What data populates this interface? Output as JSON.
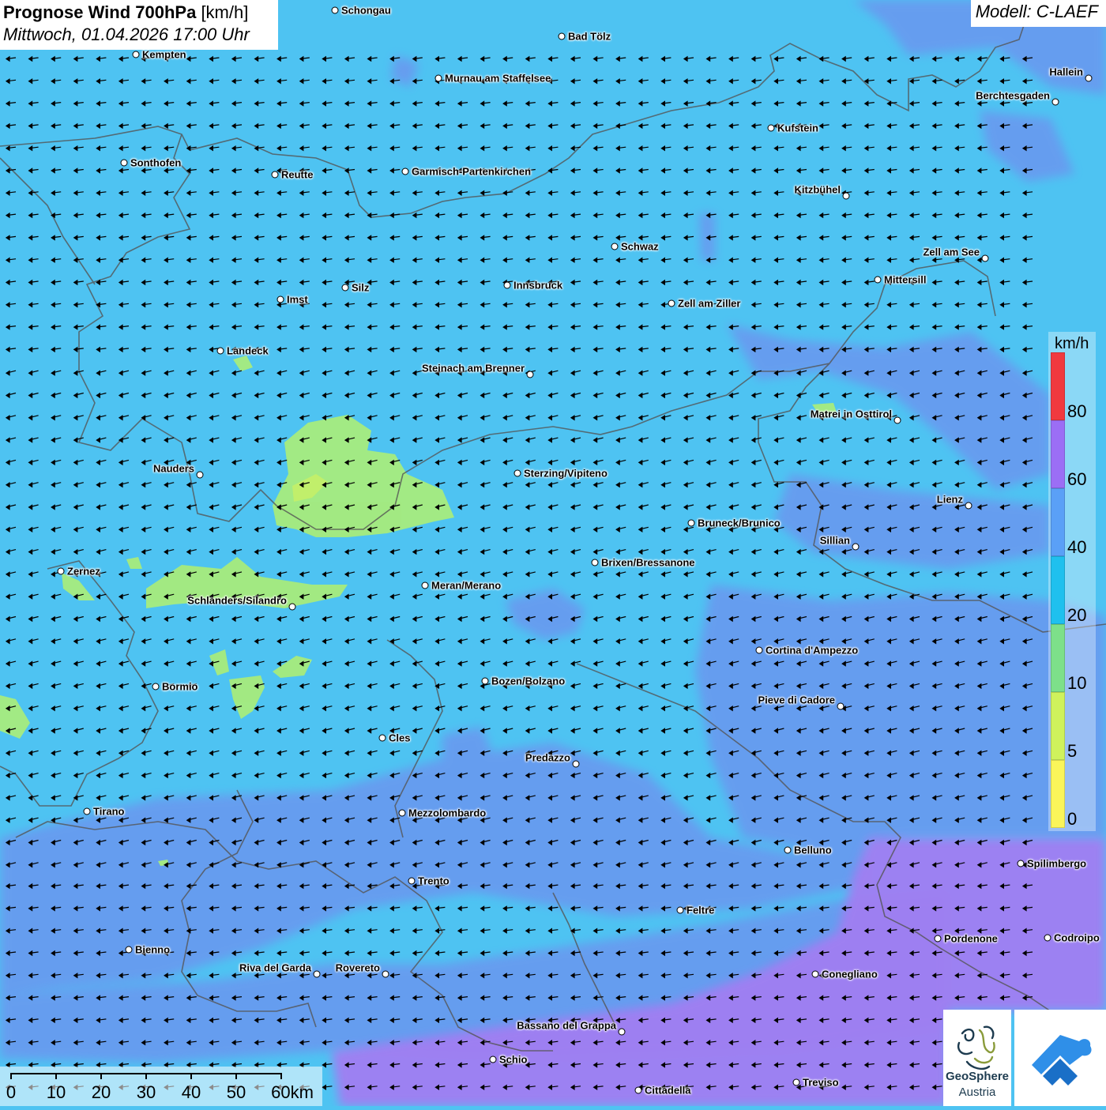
{
  "header": {
    "title_bold": "Prognose Wind 700hPa",
    "title_unit": "[km/h]",
    "datetime": "Mittwoch, 01.04.2026 17:00 Uhr",
    "model": "Modell: C-LAEF"
  },
  "legend": {
    "unit": "km/h",
    "ticks": [
      "80",
      "60",
      "40",
      "20",
      "10",
      "5",
      "0"
    ],
    "colors": [
      "#f0393f",
      "#9b6ef5",
      "#5aa0f7",
      "#1fc0ee",
      "#7de08a",
      "#cff25c",
      "#faf55a"
    ]
  },
  "scalebar": {
    "labels": [
      "0",
      "10",
      "20",
      "30",
      "40",
      "50",
      "60km"
    ]
  },
  "logos": {
    "geosphere_line1": "GeoSphere",
    "geosphere_line2": "Austria"
  },
  "wind": {
    "direction": "from east-northeast (arrows pointing west-southwest)"
  },
  "cities": [
    {
      "name": "Schongau",
      "label": "Schongau",
      "side": "right"
    },
    {
      "name": "Bad Tölz",
      "label": "Bad Tölz",
      "side": "right"
    },
    {
      "name": "Kempten",
      "label": "Kempten",
      "side": "right"
    },
    {
      "name": "Murnau am Staffelsee",
      "label": "Murnau am Staffelsee",
      "side": "right"
    },
    {
      "name": "Hallein",
      "label": "Hallein",
      "side": "left"
    },
    {
      "name": "Berchtesgaden",
      "label": "Berchtesgaden",
      "side": "left"
    },
    {
      "name": "Kufstein",
      "label": "Kufstein",
      "side": "right"
    },
    {
      "name": "Sonthofen",
      "label": "Sonthofen",
      "side": "right"
    },
    {
      "name": "Reutte",
      "label": "Reutte",
      "side": "right"
    },
    {
      "name": "Garmisch-Partenkirchen",
      "label": "Garmisch-Partenkirchen",
      "side": "right"
    },
    {
      "name": "Kitzbühel",
      "label": "Kitzbühel",
      "side": "left"
    },
    {
      "name": "Schwaz",
      "label": "Schwaz",
      "side": "right"
    },
    {
      "name": "Zell am See",
      "label": "Zell am See",
      "side": "left"
    },
    {
      "name": "Mittersill",
      "label": "Mittersill",
      "side": "right"
    },
    {
      "name": "Innsbruck",
      "label": "Innsbruck",
      "side": "right"
    },
    {
      "name": "Silz",
      "label": "Silz",
      "side": "right"
    },
    {
      "name": "Imst",
      "label": "Imst",
      "side": "right"
    },
    {
      "name": "Zell am Ziller",
      "label": "Zell am Ziller",
      "side": "right"
    },
    {
      "name": "Landeck",
      "label": "Landeck",
      "side": "right"
    },
    {
      "name": "Steinach am Brenner",
      "label": "Steinach am Brenner",
      "side": "left"
    },
    {
      "name": "Matrei in Osttirol",
      "label": "Matrei in Osttirol",
      "side": "left"
    },
    {
      "name": "Nauders",
      "label": "Nauders",
      "side": "left"
    },
    {
      "name": "Sterzing/Vipiteno",
      "label": "Sterzing/Vipiteno",
      "side": "right"
    },
    {
      "name": "Lienz",
      "label": "Lienz",
      "side": "left"
    },
    {
      "name": "Bruneck/Brunico",
      "label": "Bruneck/Brunico",
      "side": "right"
    },
    {
      "name": "Sillian",
      "label": "Sillian",
      "side": "left"
    },
    {
      "name": "Brixen/Bressanone",
      "label": "Brixen/Bressanone",
      "side": "right"
    },
    {
      "name": "Zernez",
      "label": "Zernez",
      "side": "right"
    },
    {
      "name": "Meran/Merano",
      "label": "Meran/Merano",
      "side": "right"
    },
    {
      "name": "Schlanders/Silandro",
      "label": "Schlanders/Silandro",
      "side": "left"
    },
    {
      "name": "Cortina d'Ampezzo",
      "label": "Cortina d'Ampezzo",
      "side": "right"
    },
    {
      "name": "Bozen/Bolzano",
      "label": "Bozen/Bolzano",
      "side": "right"
    },
    {
      "name": "Bormio",
      "label": "Bormio",
      "side": "right"
    },
    {
      "name": "Pieve di Cadore",
      "label": "Pieve di Cadore",
      "side": "left"
    },
    {
      "name": "Cles",
      "label": "Cles",
      "side": "right"
    },
    {
      "name": "Predazzo",
      "label": "Predazzo",
      "side": "left"
    },
    {
      "name": "Tirano",
      "label": "Tirano",
      "side": "right"
    },
    {
      "name": "Mezzolombardo",
      "label": "Mezzolombardo",
      "side": "right"
    },
    {
      "name": "Belluno",
      "label": "Belluno",
      "side": "right"
    },
    {
      "name": "Spilimbergo",
      "label": "Spilimbergo",
      "side": "right"
    },
    {
      "name": "Trento",
      "label": "Trento",
      "side": "right"
    },
    {
      "name": "Feltre",
      "label": "Feltre",
      "side": "right"
    },
    {
      "name": "Pordenone",
      "label": "Pordenone",
      "side": "right"
    },
    {
      "name": "Codroipo",
      "label": "Codroipo",
      "side": "right"
    },
    {
      "name": "Bienno",
      "label": "Bienno",
      "side": "right"
    },
    {
      "name": "Riva del Garda",
      "label": "Riva del Garda",
      "side": "left"
    },
    {
      "name": "Rovereto",
      "label": "Rovereto",
      "side": "left"
    },
    {
      "name": "Conegliano",
      "label": "Conegliano",
      "side": "right"
    },
    {
      "name": "Bassano del Grappa",
      "label": "Bassano del Grappa",
      "side": "left"
    },
    {
      "name": "Schio",
      "label": "Schio",
      "side": "right"
    },
    {
      "name": "Treviso",
      "label": "Treviso",
      "side": "right"
    },
    {
      "name": "Cittadella",
      "label": "Cittadella",
      "side": "right"
    }
  ]
}
